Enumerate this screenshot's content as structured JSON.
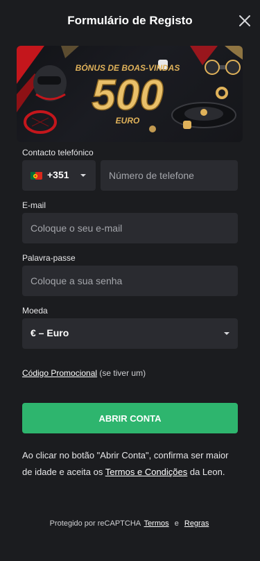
{
  "header": {
    "title": "Formulário de Registo"
  },
  "banner": {
    "line1": "BÓNUS DE BOAS-VINDAS",
    "amount": "500",
    "currency": "EURO"
  },
  "phone": {
    "label": "Contacto telefónico",
    "dial_code": "+351",
    "placeholder": "Número de telefone"
  },
  "email": {
    "label": "E-mail",
    "placeholder": "Coloque o seu e-mail"
  },
  "password": {
    "label": "Palavra-passe",
    "placeholder": "Coloque a sua senha"
  },
  "currency": {
    "label": "Moeda",
    "value": "€ – Euro"
  },
  "promo": {
    "link": "Código Promocional",
    "hint": "(se tiver um)"
  },
  "submit": {
    "label": "ABRIR CONTA"
  },
  "terms": {
    "before": "Ao clicar no botão \"Abrir Conta\", confirma ser maior de idade e aceita os ",
    "link": "Termos e Condições",
    "after": " da Leon."
  },
  "recaptcha": {
    "text": "Protegido por reCAPTCHA",
    "terms_link": "Termos",
    "and": "e",
    "rules_link": "Regras"
  },
  "colors": {
    "background": "#1b1c1f",
    "field": "#2a2b30",
    "accent_green": "#2eb56e",
    "gold": "#e0b25a"
  },
  "icons": {
    "close": "close-icon",
    "flag": "portugal-flag-icon",
    "caret": "chevron-down-icon"
  }
}
